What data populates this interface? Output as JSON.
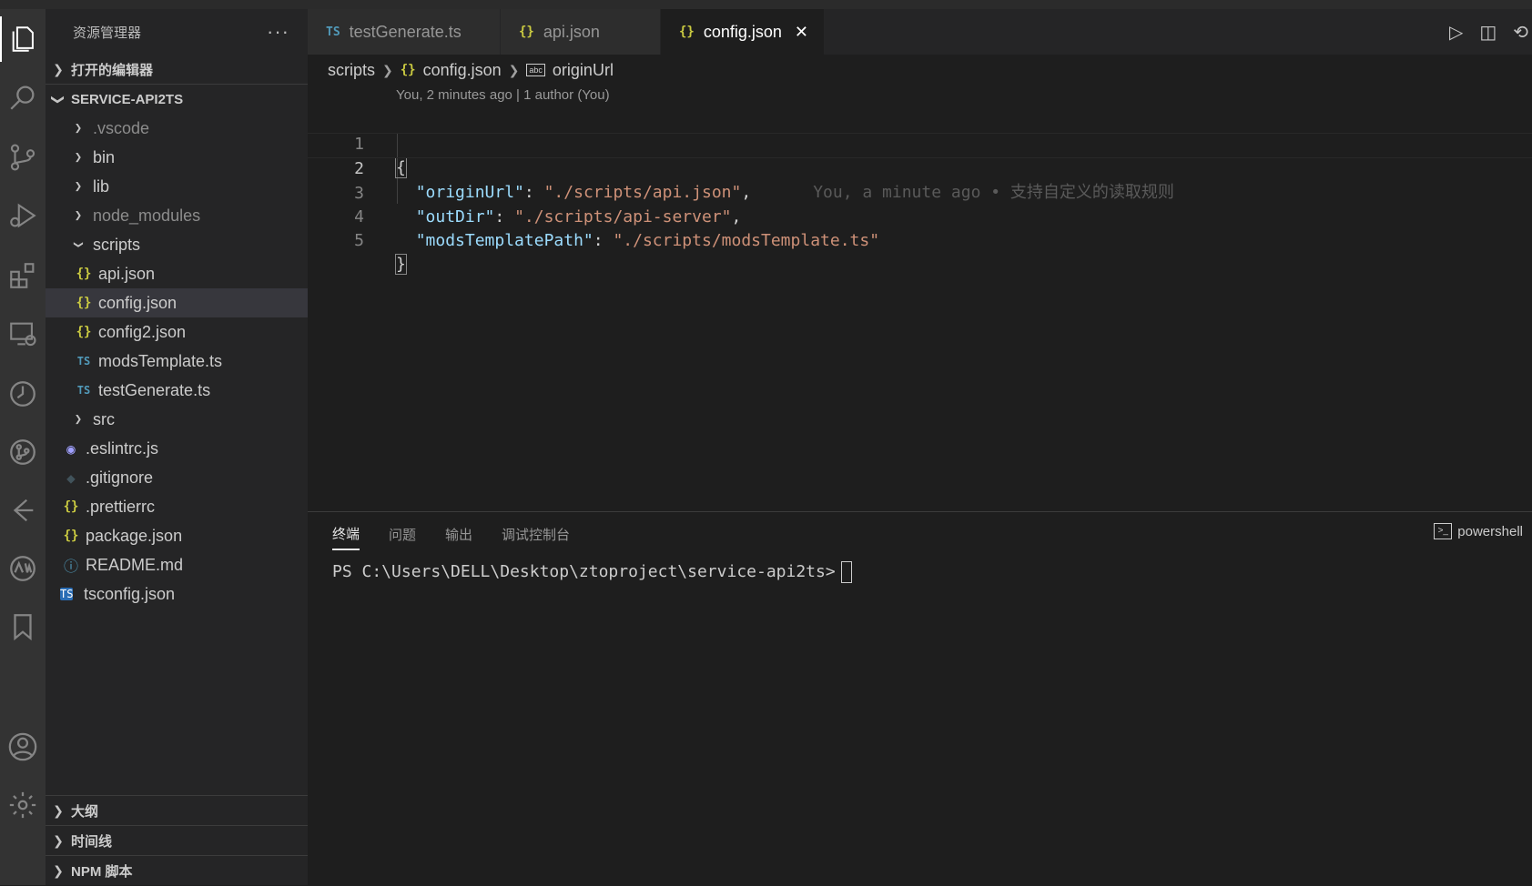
{
  "activitybar": {
    "icons": [
      "explorer-icon",
      "search-icon",
      "source-control-icon",
      "run-debug-icon",
      "extensions-icon",
      "remote-explorer-icon",
      "timeline-icon",
      "git-graph-icon",
      "live-share-icon",
      "aw-icon",
      "bookmarks-icon",
      "account-icon",
      "settings-gear-icon"
    ]
  },
  "sidebar": {
    "title": "资源管理器",
    "more": "···",
    "open_editors": "打开的编辑器",
    "project": "SERVICE-API2TS",
    "tree": [
      {
        "label": ".vscode",
        "type": "folder",
        "dim": true
      },
      {
        "label": "bin",
        "type": "folder"
      },
      {
        "label": "lib",
        "type": "folder"
      },
      {
        "label": "node_modules",
        "type": "folder",
        "dim": true
      },
      {
        "label": "scripts",
        "type": "folder-open"
      },
      {
        "label": "api.json",
        "type": "json"
      },
      {
        "label": "config.json",
        "type": "json",
        "selected": true
      },
      {
        "label": "config2.json",
        "type": "json"
      },
      {
        "label": "modsTemplate.ts",
        "type": "ts"
      },
      {
        "label": "testGenerate.ts",
        "type": "ts"
      },
      {
        "label": "src",
        "type": "folder"
      },
      {
        "label": ".eslintrc.js",
        "type": "eslint"
      },
      {
        "label": ".gitignore",
        "type": "git"
      },
      {
        "label": ".prettierrc",
        "type": "json"
      },
      {
        "label": "package.json",
        "type": "json"
      },
      {
        "label": "README.md",
        "type": "info"
      },
      {
        "label": "tsconfig.json",
        "type": "tsconfig"
      }
    ],
    "outline": "大纲",
    "timeline": "时间线",
    "npm": "NPM 脚本"
  },
  "tabs": [
    {
      "label": "testGenerate.ts",
      "icon": "TS"
    },
    {
      "label": "api.json",
      "icon": "{}"
    },
    {
      "label": "config.json",
      "icon": "{}",
      "active": true,
      "close": "✕"
    }
  ],
  "breadcrumb": {
    "folder": "scripts",
    "file": "config.json",
    "symbol": "originUrl",
    "json_icon": "{}",
    "abc_icon": "abc"
  },
  "codelens": "You, 2 minutes ago | 1 author (You)",
  "code": {
    "line_numbers": [
      "1",
      "2",
      "3",
      "4",
      "5"
    ],
    "open": "{",
    "close": "}",
    "k1": "\"originUrl\"",
    "v1": "\"./scripts/api.json\"",
    "k2": "\"outDir\"",
    "v2": "\"./scripts/api-server\"",
    "k3": "\"modsTemplatePath\"",
    "v3": "\"./scripts/modsTemplate.ts\"",
    "blame": "You, a minute ago • 支持自定义的读取规则"
  },
  "panel": {
    "tabs": [
      "终端",
      "问题",
      "输出",
      "调试控制台"
    ],
    "shell": "powershell",
    "prompt": "PS C:\\Users\\DELL\\Desktop\\ztoproject\\service-api2ts>"
  }
}
